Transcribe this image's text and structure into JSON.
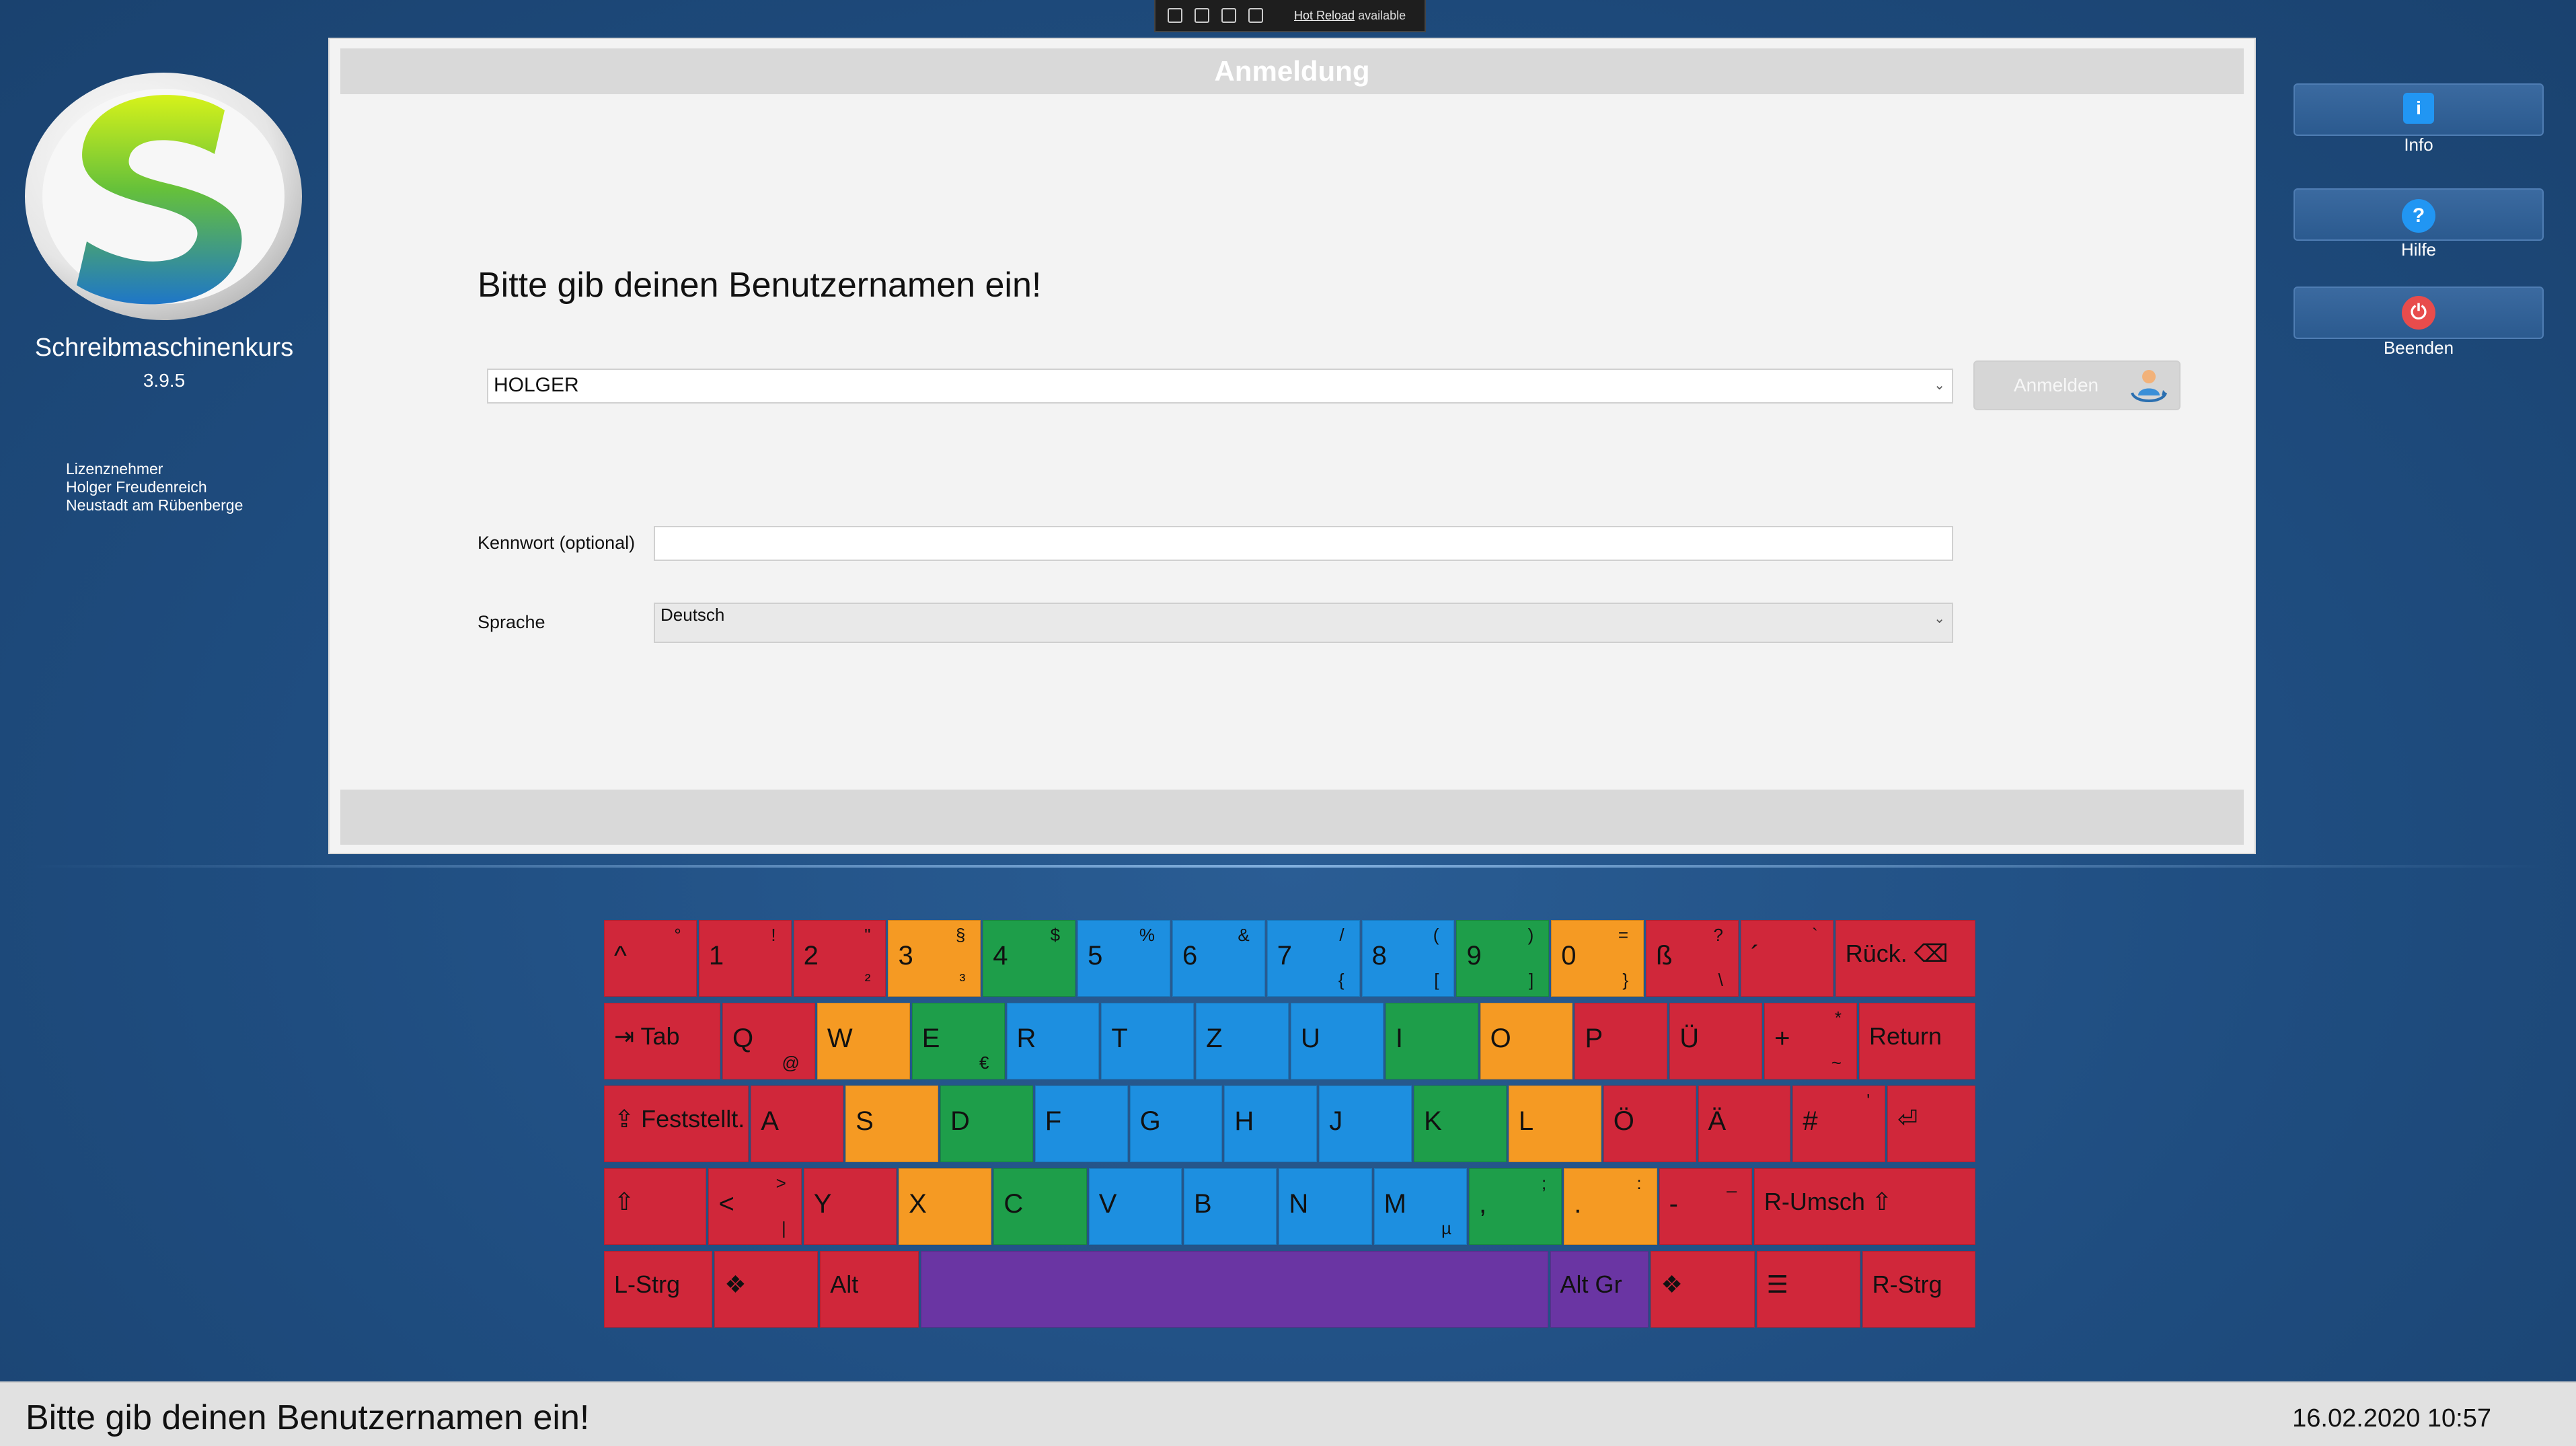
{
  "app": {
    "name": "Schreibmaschinenkurs",
    "version": "3.9.5"
  },
  "license": {
    "title": "Lizenznehmer",
    "name": "Holger Freudenreich",
    "location": "Neustadt am Rübenberge"
  },
  "devbar": {
    "hot_reload_link": "Hot Reload",
    "hot_reload_suffix": "available"
  },
  "dialog": {
    "title": "Anmeldung",
    "prompt": "Bitte gib deinen Benutzernamen ein!",
    "username_value": "HOLGER",
    "login_button": "Anmelden",
    "password_label": "Kennwort (optional)",
    "password_value": "",
    "language_label": "Sprache",
    "language_value": "Deutsch"
  },
  "sidebar": {
    "info": "Info",
    "help": "Hilfe",
    "quit": "Beenden"
  },
  "status": {
    "message": "Bitte gib deinen Benutzernamen ein!",
    "datetime": "16.02.2020 10:57"
  },
  "colors": {
    "background": "#1f4f82",
    "dialog": "#f3f3f3",
    "key_red": "#d0273a",
    "key_orange": "#f59a23",
    "key_green": "#1e9e4a",
    "key_blue": "#1d8fe0",
    "key_purple": "#6a35a3",
    "info_icon": "#2196f3",
    "quit_icon": "#e84c4c"
  },
  "keyboard": {
    "rows": [
      [
        {
          "main": "^",
          "top": "°",
          "bottom": "",
          "color": "red",
          "w": 1
        },
        {
          "main": "1",
          "top": "!",
          "bottom": "",
          "color": "red",
          "w": 1
        },
        {
          "main": "2",
          "top": "\"",
          "bottom": "²",
          "color": "red",
          "w": 1
        },
        {
          "main": "3",
          "top": "§",
          "bottom": "³",
          "color": "orange",
          "w": 1
        },
        {
          "main": "4",
          "top": "$",
          "bottom": "",
          "color": "green",
          "w": 1
        },
        {
          "main": "5",
          "top": "%",
          "bottom": "",
          "color": "blue",
          "w": 1
        },
        {
          "main": "6",
          "top": "&",
          "bottom": "",
          "color": "blue",
          "w": 1
        },
        {
          "main": "7",
          "top": "/",
          "bottom": "{",
          "color": "blue",
          "w": 1
        },
        {
          "main": "8",
          "top": "(",
          "bottom": "[",
          "color": "blue",
          "w": 1
        },
        {
          "main": "9",
          "top": ")",
          "bottom": "]",
          "color": "green",
          "w": 1
        },
        {
          "main": "0",
          "top": "=",
          "bottom": "}",
          "color": "orange",
          "w": 1
        },
        {
          "main": "ß",
          "top": "?",
          "bottom": "\\",
          "color": "red",
          "w": 1
        },
        {
          "main": "´",
          "top": "`",
          "bottom": "",
          "color": "red",
          "w": 1
        },
        {
          "main": "Rück. ⌫",
          "top": "",
          "bottom": "",
          "color": "red",
          "w": 1.5,
          "label": true
        }
      ],
      [
        {
          "main": "⇥ Tab",
          "top": "",
          "bottom": "",
          "color": "red",
          "w": 1.25,
          "label": true
        },
        {
          "main": "Q",
          "top": "",
          "bottom": "@",
          "color": "red",
          "w": 1
        },
        {
          "main": "W",
          "top": "",
          "bottom": "",
          "color": "orange",
          "w": 1
        },
        {
          "main": "E",
          "top": "",
          "bottom": "€",
          "color": "green",
          "w": 1
        },
        {
          "main": "R",
          "top": "",
          "bottom": "",
          "color": "blue",
          "w": 1
        },
        {
          "main": "T",
          "top": "",
          "bottom": "",
          "color": "blue",
          "w": 1
        },
        {
          "main": "Z",
          "top": "",
          "bottom": "",
          "color": "blue",
          "w": 1
        },
        {
          "main": "U",
          "top": "",
          "bottom": "",
          "color": "blue",
          "w": 1
        },
        {
          "main": "I",
          "top": "",
          "bottom": "",
          "color": "green",
          "w": 1
        },
        {
          "main": "O",
          "top": "",
          "bottom": "",
          "color": "orange",
          "w": 1
        },
        {
          "main": "P",
          "top": "",
          "bottom": "",
          "color": "red",
          "w": 1
        },
        {
          "main": "Ü",
          "top": "",
          "bottom": "",
          "color": "red",
          "w": 1
        },
        {
          "main": "+",
          "top": "*",
          "bottom": "~",
          "color": "red",
          "w": 1
        },
        {
          "main": "Return",
          "top": "",
          "bottom": "",
          "color": "red",
          "w": 1.25,
          "label": true
        }
      ],
      [
        {
          "main": "⇪ Feststellt.",
          "top": "",
          "bottom": "",
          "color": "red",
          "w": 1.55,
          "label": true
        },
        {
          "main": "A",
          "top": "",
          "bottom": "",
          "color": "red",
          "w": 1
        },
        {
          "main": "S",
          "top": "",
          "bottom": "",
          "color": "orange",
          "w": 1
        },
        {
          "main": "D",
          "top": "",
          "bottom": "",
          "color": "green",
          "w": 1
        },
        {
          "main": "F",
          "top": "",
          "bottom": "",
          "color": "blue",
          "w": 1
        },
        {
          "main": "G",
          "top": "",
          "bottom": "",
          "color": "blue",
          "w": 1
        },
        {
          "main": "H",
          "top": "",
          "bottom": "",
          "color": "blue",
          "w": 1
        },
        {
          "main": "J",
          "top": "",
          "bottom": "",
          "color": "blue",
          "w": 1
        },
        {
          "main": "K",
          "top": "",
          "bottom": "",
          "color": "green",
          "w": 1
        },
        {
          "main": "L",
          "top": "",
          "bottom": "",
          "color": "orange",
          "w": 1
        },
        {
          "main": "Ö",
          "top": "",
          "bottom": "",
          "color": "red",
          "w": 1
        },
        {
          "main": "Ä",
          "top": "",
          "bottom": "",
          "color": "red",
          "w": 1
        },
        {
          "main": "#",
          "top": "'",
          "bottom": "",
          "color": "red",
          "w": 1
        },
        {
          "main": "⏎",
          "top": "",
          "bottom": "",
          "color": "red",
          "w": 0.95,
          "label": true
        }
      ],
      [
        {
          "main": "⇧",
          "top": "",
          "bottom": "",
          "color": "red",
          "w": 1.1,
          "label": true
        },
        {
          "main": "<",
          "top": ">",
          "bottom": "|",
          "color": "red",
          "w": 1
        },
        {
          "main": "Y",
          "top": "",
          "bottom": "",
          "color": "red",
          "w": 1
        },
        {
          "main": "X",
          "top": "",
          "bottom": "",
          "color": "orange",
          "w": 1
        },
        {
          "main": "C",
          "top": "",
          "bottom": "",
          "color": "green",
          "w": 1
        },
        {
          "main": "V",
          "top": "",
          "bottom": "",
          "color": "blue",
          "w": 1
        },
        {
          "main": "B",
          "top": "",
          "bottom": "",
          "color": "blue",
          "w": 1
        },
        {
          "main": "N",
          "top": "",
          "bottom": "",
          "color": "blue",
          "w": 1
        },
        {
          "main": "M",
          "top": "",
          "bottom": "µ",
          "color": "blue",
          "w": 1
        },
        {
          "main": ",",
          "top": ";",
          "bottom": "",
          "color": "green",
          "w": 1
        },
        {
          "main": ".",
          "top": ":",
          "bottom": "",
          "color": "orange",
          "w": 1
        },
        {
          "main": "-",
          "top": "_",
          "bottom": "",
          "color": "red",
          "w": 1
        },
        {
          "main": "R-Umsch ⇧",
          "top": "",
          "bottom": "",
          "color": "red",
          "w": 2.35,
          "label": true
        }
      ],
      [
        {
          "main": "L-Strg",
          "top": "",
          "bottom": "",
          "color": "red",
          "w": 1.15,
          "label": true
        },
        {
          "main": "❖",
          "top": "",
          "bottom": "",
          "color": "red",
          "w": 1.1,
          "label": true
        },
        {
          "main": "Alt",
          "top": "",
          "bottom": "",
          "color": "red",
          "w": 1.05,
          "label": true
        },
        {
          "main": "",
          "top": "",
          "bottom": "",
          "color": "purple",
          "w": 6.55,
          "label": true
        },
        {
          "main": "Alt Gr",
          "top": "",
          "bottom": "",
          "color": "purple",
          "w": 1.05,
          "label": true
        },
        {
          "main": "❖",
          "top": "",
          "bottom": "",
          "color": "red",
          "w": 1.1,
          "label": true
        },
        {
          "main": "☰",
          "top": "",
          "bottom": "",
          "color": "red",
          "w": 1.1,
          "label": true
        },
        {
          "main": "R-Strg",
          "top": "",
          "bottom": "",
          "color": "red",
          "w": 1.2,
          "label": true
        }
      ]
    ]
  }
}
